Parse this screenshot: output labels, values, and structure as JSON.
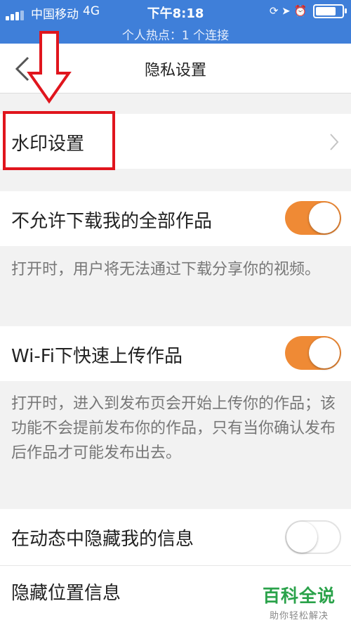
{
  "status_bar": {
    "carrier": "中国移动",
    "network": "4G",
    "time": "下午8:18",
    "hotspot": "个人热点：1 个连接"
  },
  "nav": {
    "title": "隐私设置"
  },
  "watermark_setting": {
    "label": "水印设置"
  },
  "settings": [
    {
      "label": "不允许下载我的全部作品",
      "enabled": true,
      "description": "打开时，用户将无法通过下载分享你的视频。"
    },
    {
      "label": "Wi-Fi下快速上传作品",
      "enabled": true,
      "description": "打开时，进入到发布页会开始上传你的作品；该功能不会提前发布你的作品，只有当你确认发布后作品才可能发布出去。"
    },
    {
      "label": "在动态中隐藏我的信息",
      "enabled": false
    },
    {
      "label": "隐藏位置信息"
    }
  ],
  "watermark_logo": {
    "title": "百科全说",
    "subtitle": "助你轻松解决"
  },
  "colors": {
    "status_bar": "#3f7fd9",
    "toggle_on": "#ef8a35",
    "annotation_red": "#e0151d",
    "logo_green": "#2aa24a"
  }
}
